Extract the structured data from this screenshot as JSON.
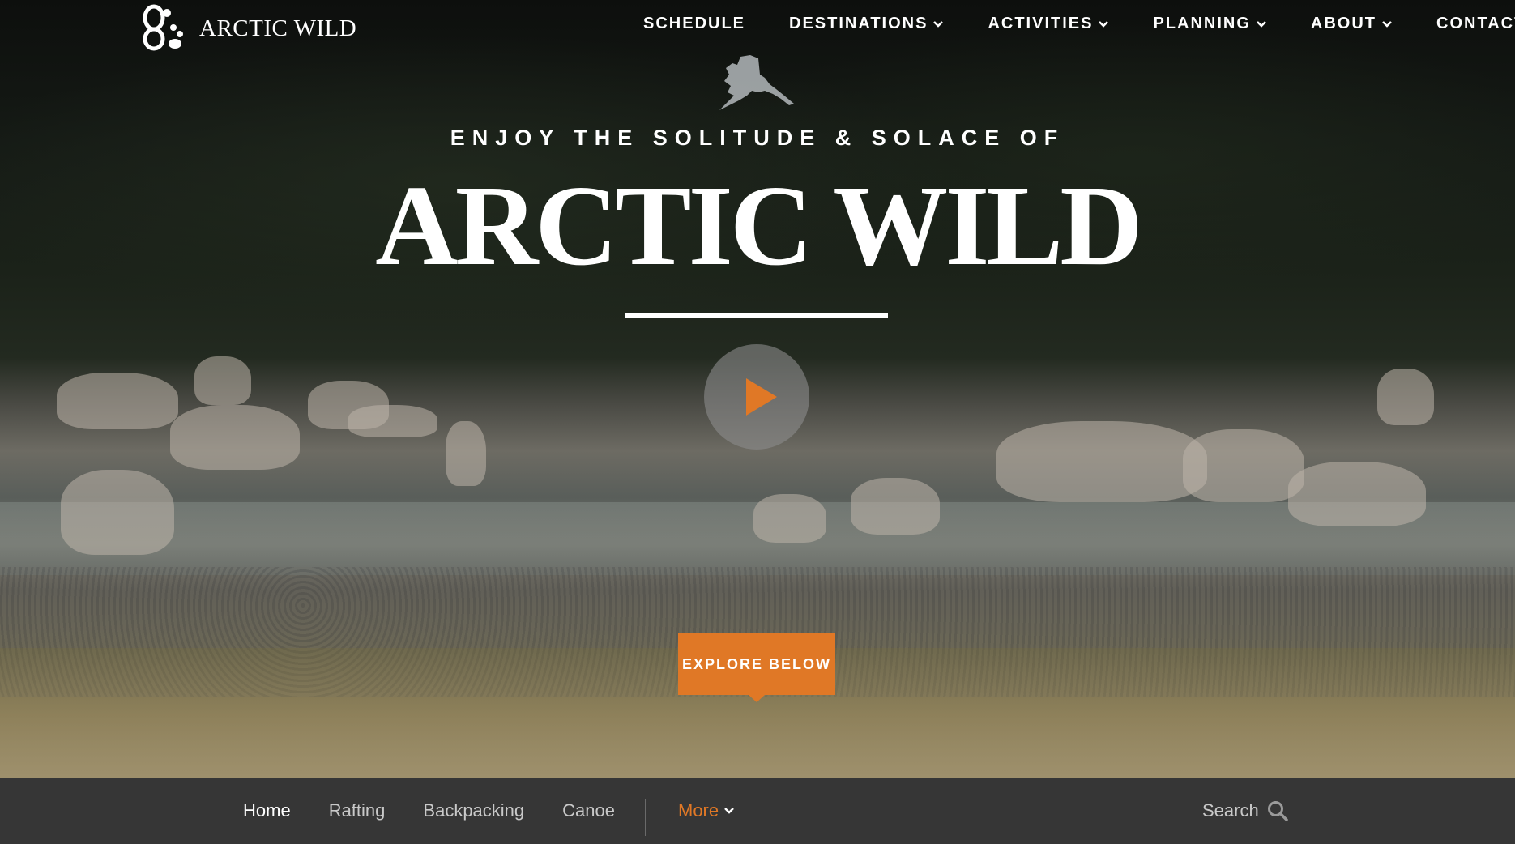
{
  "brand": {
    "name": "ARCTIC WILD"
  },
  "nav": {
    "items": [
      {
        "label": "SCHEDULE",
        "has_dropdown": false
      },
      {
        "label": "DESTINATIONS",
        "has_dropdown": true
      },
      {
        "label": "ACTIVITIES",
        "has_dropdown": true
      },
      {
        "label": "PLANNING",
        "has_dropdown": true
      },
      {
        "label": "ABOUT",
        "has_dropdown": true
      },
      {
        "label": "CONTACT",
        "has_dropdown": false
      }
    ]
  },
  "hero": {
    "tagline": "ENJOY THE SOLITUDE & SOLACE OF",
    "title": "ARCTIC WILD",
    "cta_label": "EXPLORE BELOW"
  },
  "subnav": {
    "links": [
      {
        "label": "Home",
        "active": true
      },
      {
        "label": "Rafting",
        "active": false
      },
      {
        "label": "Backpacking",
        "active": false
      },
      {
        "label": "Canoe",
        "active": false
      }
    ],
    "more_label": "More",
    "search_label": "Search"
  },
  "colors": {
    "accent": "#e07826",
    "subnav_bg": "#363636"
  },
  "icons": [
    "logo-paw-icon",
    "chevron-down-icon",
    "alaska-map-icon",
    "play-icon",
    "search-icon"
  ]
}
